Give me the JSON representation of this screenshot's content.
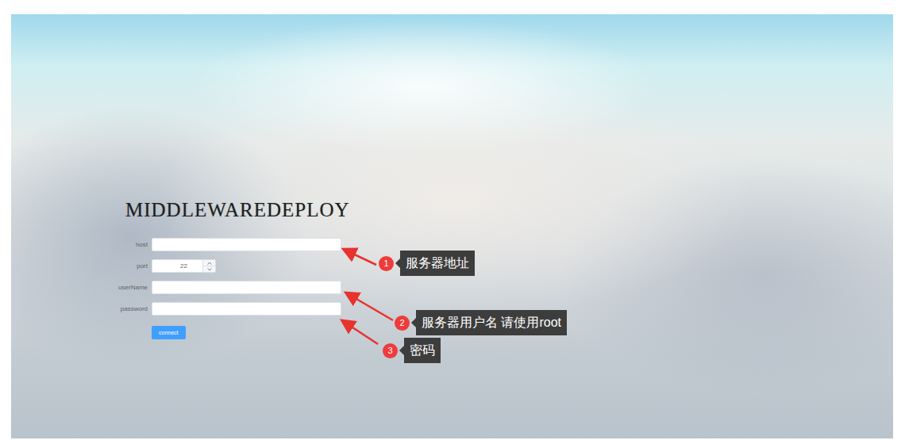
{
  "title": "MIDDLEWAREDEPLOY",
  "fields": [
    {
      "label": "host",
      "value": "",
      "kind": "text"
    },
    {
      "label": "port",
      "value": "22",
      "kind": "number"
    },
    {
      "label": "userName",
      "value": "",
      "kind": "text"
    },
    {
      "label": "password",
      "value": "",
      "kind": "password"
    }
  ],
  "button": "connect",
  "annotations": [
    {
      "number": "1",
      "text": "服务器地址"
    },
    {
      "number": "2",
      "text": "服务器用户名 请使用root"
    },
    {
      "number": "3",
      "text": "密码"
    }
  ]
}
